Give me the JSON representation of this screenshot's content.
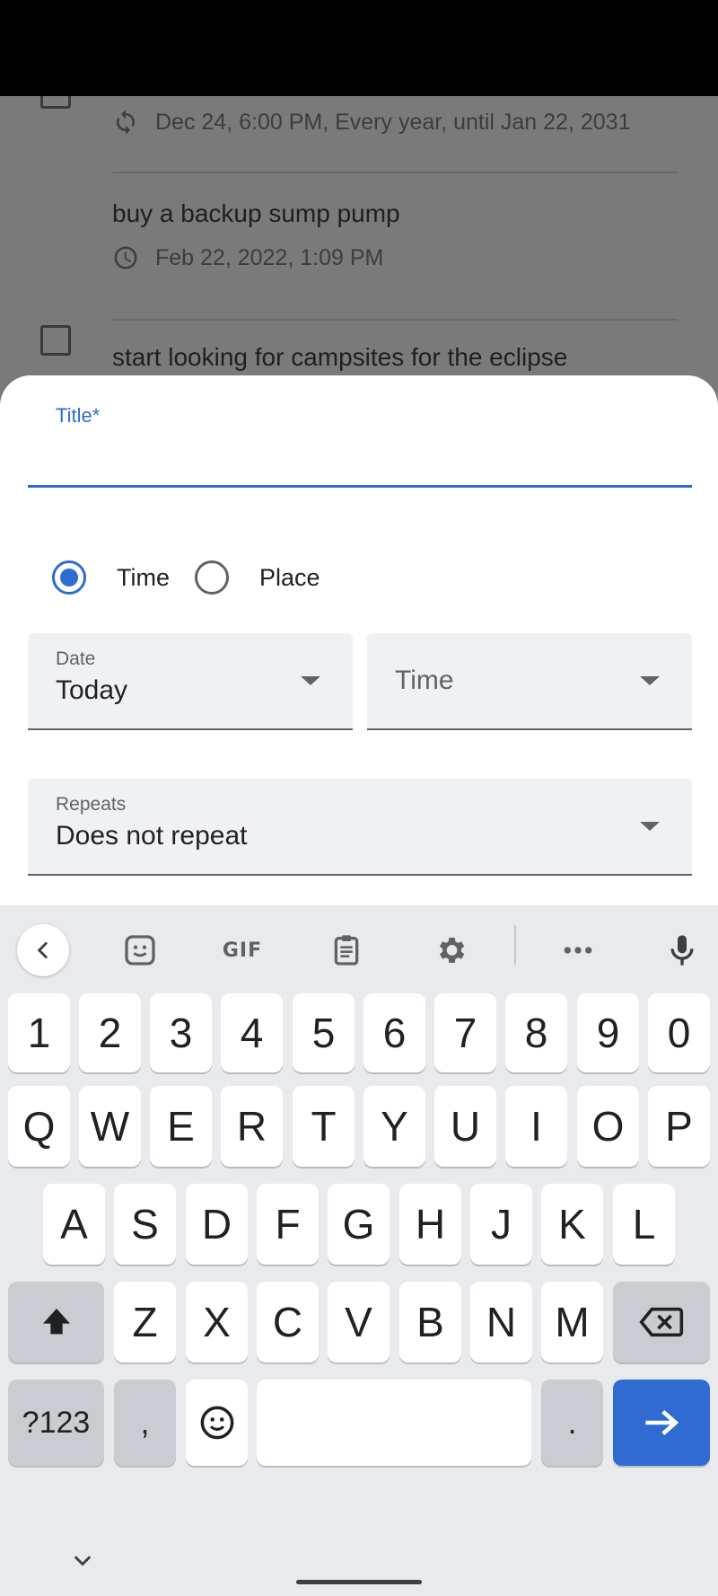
{
  "background_list": {
    "items": [
      {
        "title": "",
        "meta": "Dec 24, 6:00 PM, Every year, until Jan 22, 2031",
        "meta_icon": "repeat-icon"
      },
      {
        "title": "buy a backup sump pump",
        "meta": "Feb 22, 2022, 1:09 PM",
        "meta_icon": "clock-icon"
      },
      {
        "title": "start looking for campsites for the eclipse",
        "meta": "",
        "meta_icon": ""
      }
    ]
  },
  "form": {
    "title_label": "Title*",
    "title_value": "",
    "radio_time": "Time",
    "radio_place": "Place",
    "selected_option": "Time",
    "date_label": "Date",
    "date_value": "Today",
    "time_placeholder": "Time",
    "repeats_label": "Repeats",
    "repeats_value": "Does not repeat"
  },
  "keyboard": {
    "toolbar": [
      "back-chevron-icon",
      "sticker-icon",
      "GIF",
      "clipboard-icon",
      "settings-gear-icon",
      "more-icon",
      "microphone-icon"
    ],
    "gif_label": "GIF",
    "numbers": [
      "1",
      "2",
      "3",
      "4",
      "5",
      "6",
      "7",
      "8",
      "9",
      "0"
    ],
    "row1": [
      "Q",
      "W",
      "E",
      "R",
      "T",
      "Y",
      "U",
      "I",
      "O",
      "P"
    ],
    "row2": [
      "A",
      "S",
      "D",
      "F",
      "G",
      "H",
      "J",
      "K",
      "L"
    ],
    "row3": [
      "Z",
      "X",
      "C",
      "V",
      "B",
      "N",
      "M"
    ],
    "symbols_label": "?123",
    "comma": ",",
    "period": ".",
    "accent_color": "#2f6bd1"
  }
}
